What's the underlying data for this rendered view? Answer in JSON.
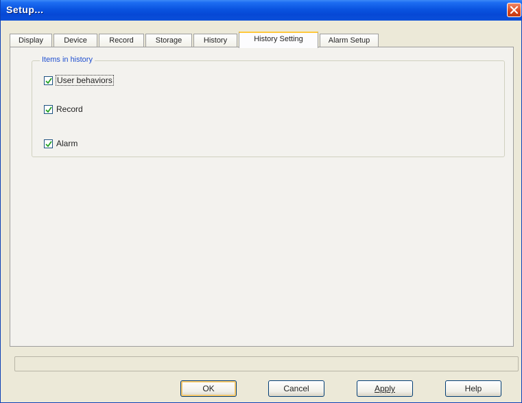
{
  "window": {
    "title": "Setup..."
  },
  "tabs": [
    {
      "label": "Display"
    },
    {
      "label": "Device"
    },
    {
      "label": "Record"
    },
    {
      "label": "Storage"
    },
    {
      "label": "History"
    },
    {
      "label": "History Setting",
      "active": true
    },
    {
      "label": "Alarm Setup"
    }
  ],
  "group": {
    "legend": "Items in history",
    "items": [
      {
        "label": "User behaviors",
        "checked": true
      },
      {
        "label": "Record",
        "checked": true
      },
      {
        "label": "Alarm",
        "checked": true
      }
    ]
  },
  "buttons": {
    "ok": "OK",
    "cancel": "Cancel",
    "apply": "Apply",
    "help": "Help"
  },
  "colors": {
    "titlebar": "#0a54e0",
    "close": "#d9461c",
    "active_tab_accent": "#ffc83c",
    "group_legend": "#1f4fd0",
    "check_mark": "#21a121"
  },
  "icons": {
    "close": "close-icon",
    "check": "check-icon"
  }
}
